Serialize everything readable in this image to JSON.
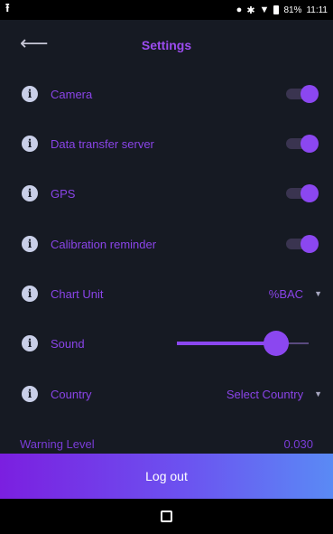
{
  "status_bar": {
    "battery": "81%",
    "time": "11:11"
  },
  "header": {
    "title": "Settings"
  },
  "settings": {
    "camera": {
      "label": "Camera",
      "enabled": true
    },
    "data_transfer": {
      "label": "Data transfer server",
      "enabled": true
    },
    "gps": {
      "label": "GPS",
      "enabled": true
    },
    "calibration": {
      "label": "Calibration reminder",
      "enabled": true
    },
    "chart_unit": {
      "label": "Chart Unit",
      "value": "%BAC"
    },
    "sound": {
      "label": "Sound",
      "level": 0.75
    },
    "country": {
      "label": "Country",
      "value": "Select Country"
    },
    "warning_level": {
      "label": "Warning Level",
      "value": "0.030"
    }
  },
  "logout": {
    "label": "Log out"
  },
  "colors": {
    "background": "#161a23",
    "accent": "#8b47f0",
    "label": "#8a44e8",
    "button_gradient_start": "#7b1fe0",
    "button_gradient_end": "#5a8af5"
  },
  "icons": {
    "status_left": "upload-icon",
    "row": "info-icon",
    "back": "arrow-left-icon",
    "nav": "recent-apps-icon"
  }
}
